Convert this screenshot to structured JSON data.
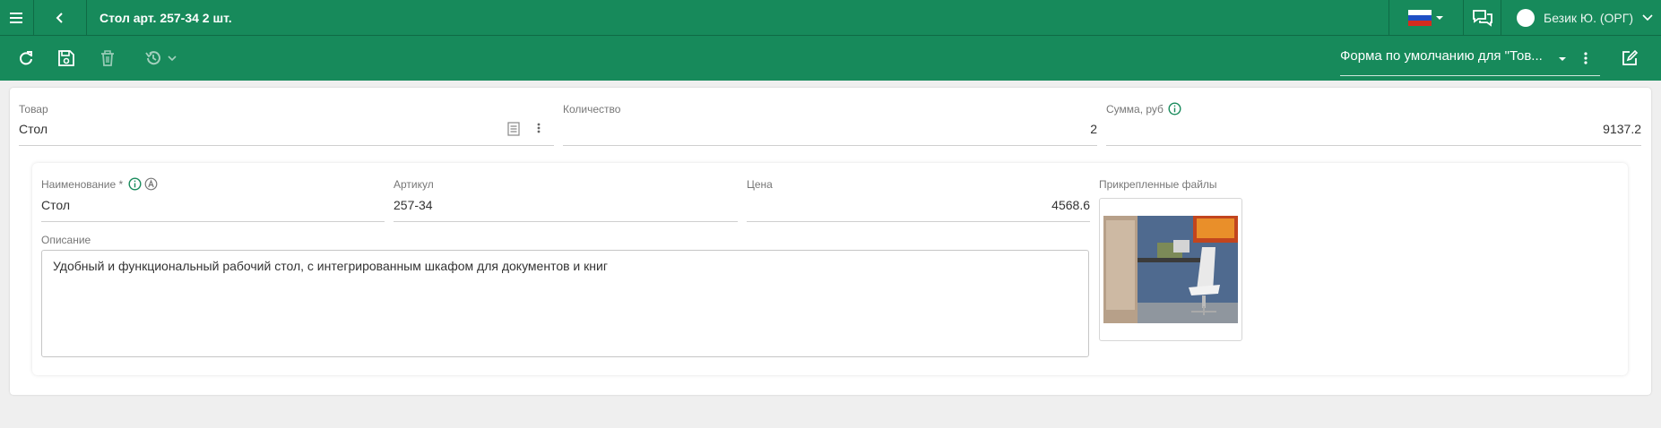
{
  "header": {
    "title": "Стол арт. 257-34 2 шт.",
    "user_name": "Безик Ю. (ОРГ)"
  },
  "toolbar": {
    "form_select_value": "Форма по умолчанию для \"Тов..."
  },
  "main": {
    "product_label": "Товар",
    "product_value": "Стол",
    "quantity_label": "Количество",
    "quantity_value": "2",
    "sum_label": "Сумма, руб",
    "sum_value": "9137.2"
  },
  "details": {
    "name_label": "Наименование *",
    "name_value": "Стол",
    "article_label": "Артикул",
    "article_value": "257-34",
    "price_label": "Цена",
    "price_value": "4568.6",
    "files_label": "Прикрепленные файлы",
    "description_label": "Описание",
    "description_value": "Удобный и функциональный рабочий стол, с интегрированным шкафом для документов и книг"
  },
  "colors": {
    "brand_green": "#178a5b",
    "info_green": "#178a5b"
  }
}
